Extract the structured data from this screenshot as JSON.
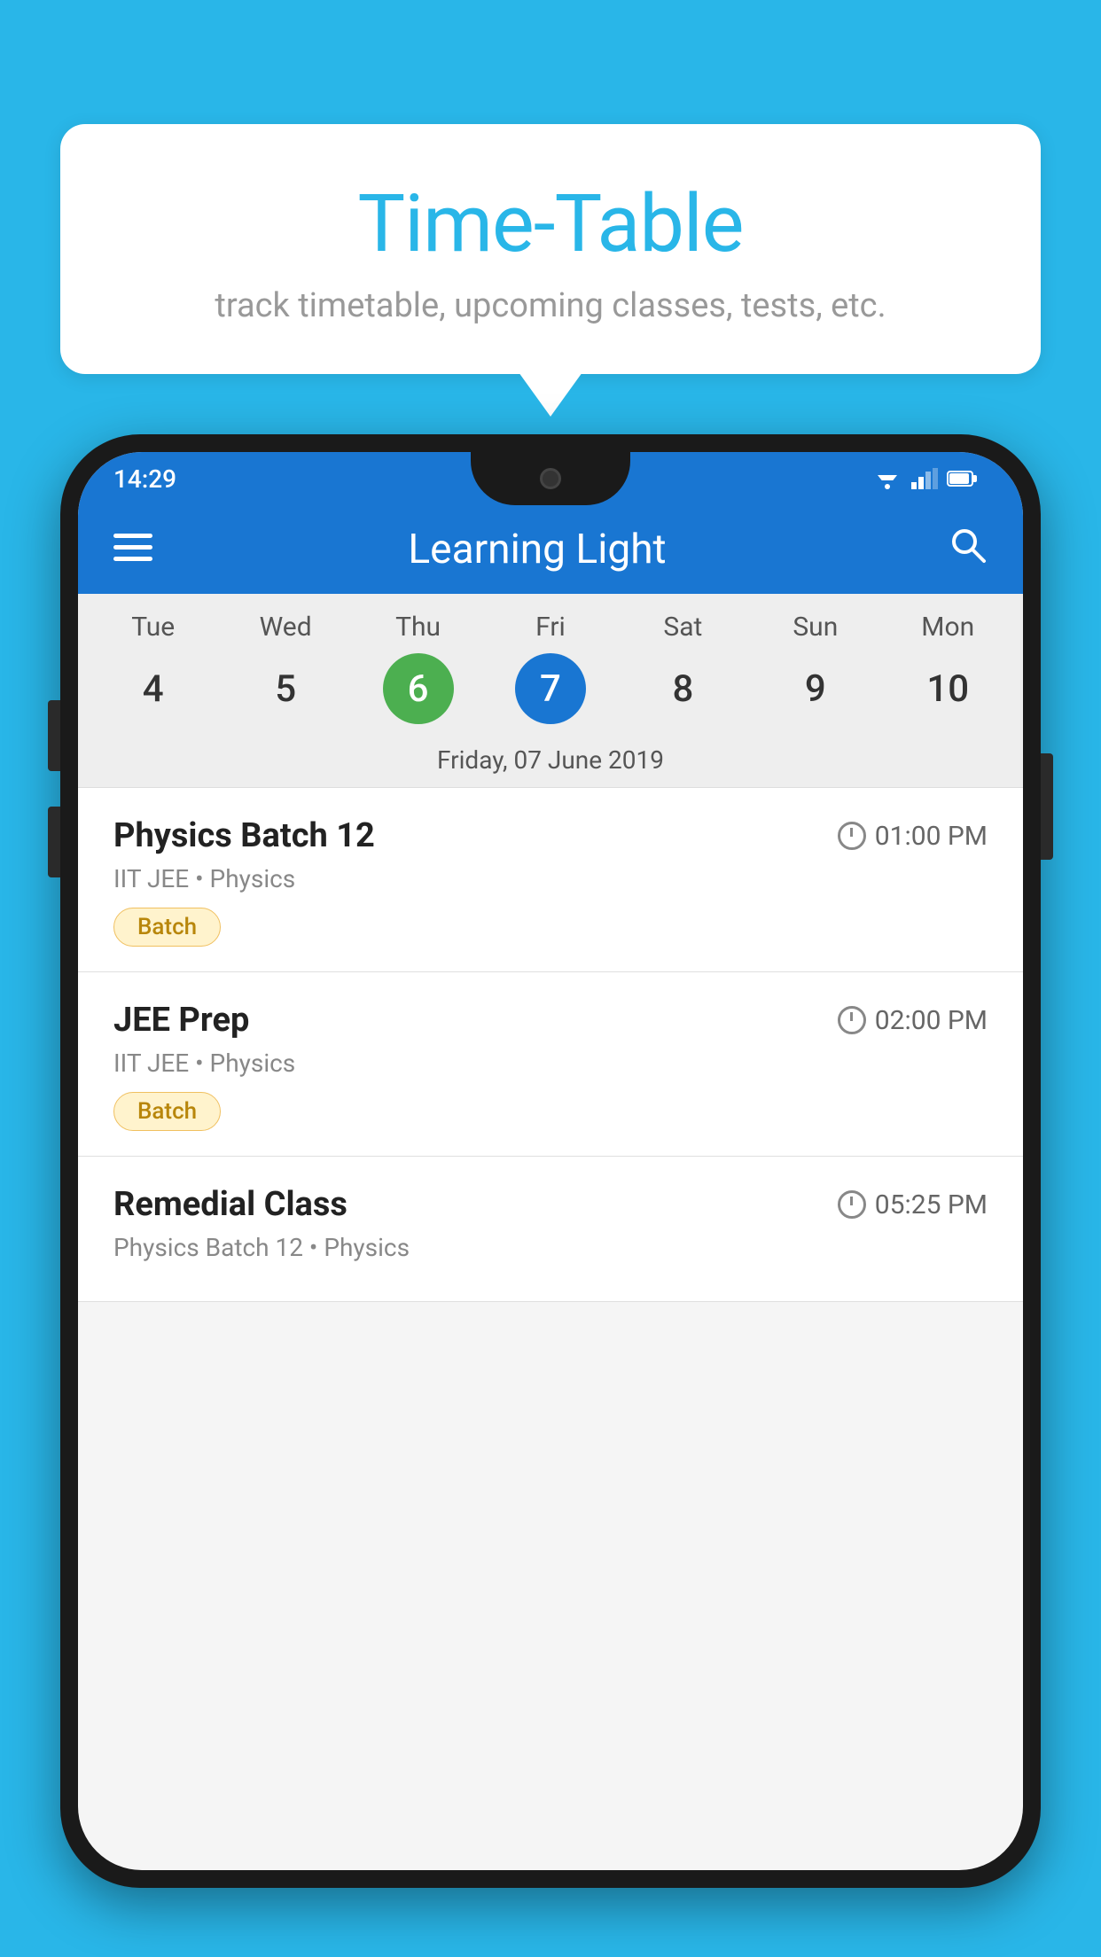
{
  "page": {
    "background_color": "#29b6e8"
  },
  "bubble": {
    "title": "Time-Table",
    "subtitle": "track timetable, upcoming classes, tests, etc."
  },
  "status_bar": {
    "time": "14:29"
  },
  "app_bar": {
    "title": "Learning Light"
  },
  "calendar": {
    "days": [
      {
        "name": "Tue",
        "number": "4",
        "state": "normal"
      },
      {
        "name": "Wed",
        "number": "5",
        "state": "normal"
      },
      {
        "name": "Thu",
        "number": "6",
        "state": "today"
      },
      {
        "name": "Fri",
        "number": "7",
        "state": "selected"
      },
      {
        "name": "Sat",
        "number": "8",
        "state": "normal"
      },
      {
        "name": "Sun",
        "number": "9",
        "state": "normal"
      },
      {
        "name": "Mon",
        "number": "10",
        "state": "normal"
      }
    ],
    "selected_date_label": "Friday, 07 June 2019"
  },
  "schedule": {
    "items": [
      {
        "title": "Physics Batch 12",
        "time": "01:00 PM",
        "subtitle": "IIT JEE • Physics",
        "badge": "Batch"
      },
      {
        "title": "JEE Prep",
        "time": "02:00 PM",
        "subtitle": "IIT JEE • Physics",
        "badge": "Batch"
      },
      {
        "title": "Remedial Class",
        "time": "05:25 PM",
        "subtitle": "Physics Batch 12 • Physics",
        "badge": null
      }
    ]
  }
}
